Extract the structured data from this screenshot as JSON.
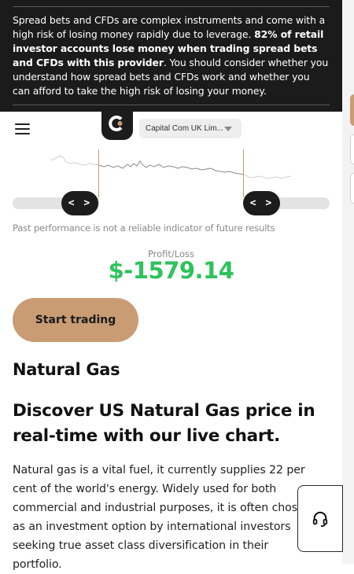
{
  "risk_banner": {
    "text_intro": "Spread bets and CFDs are complex instruments and come with a high risk of losing money rapidly due to leverage. ",
    "text_bold": "82% of retail investor accounts lose money when trading spread bets and CFDs with this provider",
    "text_outro": ". You should consider whether you understand how spread bets and CFDs work and whether you can afford to take the high risk of losing your money."
  },
  "header": {
    "menu_icon": "hamburger-menu-icon",
    "logo_icon": "capital-com-logo-icon",
    "entity_select": "Capital Com UK Lim..."
  },
  "chart": {
    "range_handle_left": "< >",
    "range_handle_right": "< >",
    "disclaimer": "Past performance is not a reliable indicator of future results",
    "profit_loss_label": "Profit/Loss",
    "profit_loss_value": "$-1579.14",
    "accent_color": "#c99c74",
    "profit_color": "#2fc25b"
  },
  "cta": {
    "start_trading": "Start trading"
  },
  "content": {
    "title": "Natural Gas",
    "subtitle": "Discover US Natural Gas price in real-time with our live chart.",
    "body": "Natural gas is a vital fuel, it currently supplies 22 per cent of the world's energy. Widely used for both commercial and industrial purposes, it is often chosen as an investment option by international investors seeking true asset class diversification in their portfolio."
  },
  "support": {
    "icon": "headset-support-icon"
  }
}
